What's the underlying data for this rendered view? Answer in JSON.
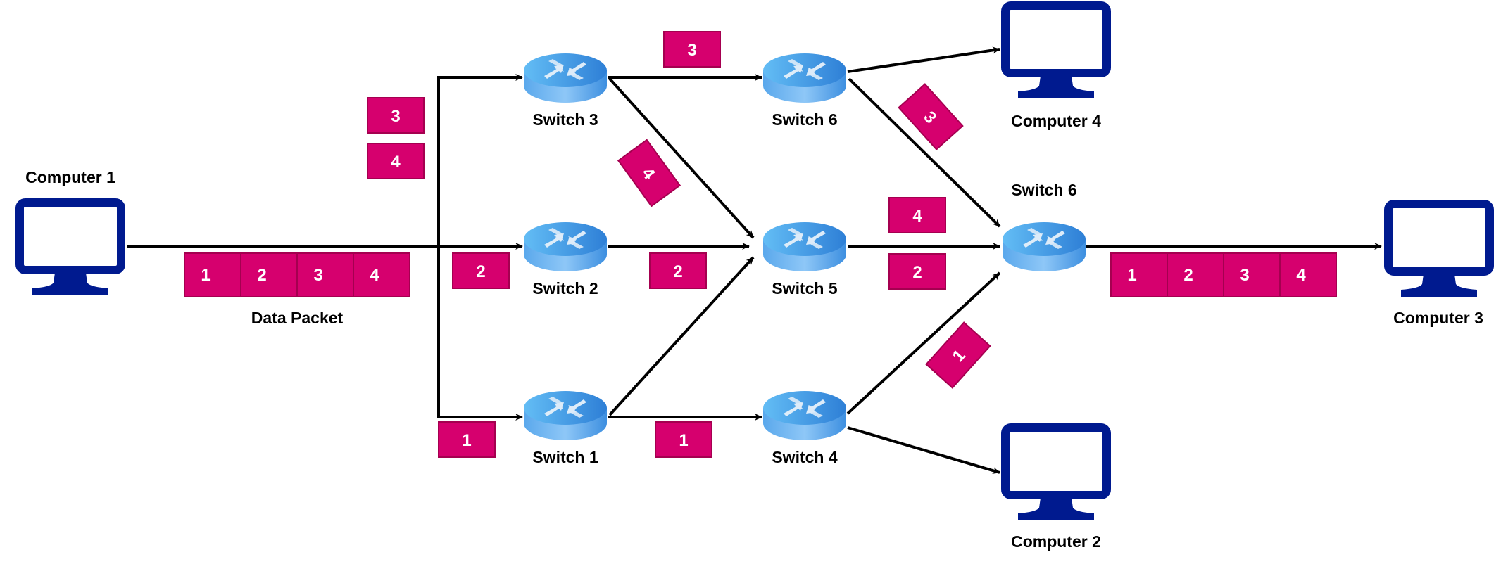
{
  "diagram": {
    "colors": {
      "packet_fill": "#D6006E",
      "packet_border": "#A50050",
      "computer": "#001A8F",
      "switch_top": "#5AB4F0",
      "switch_side": "#3D8FE0",
      "edge": "#000000"
    },
    "nodes": {
      "computer1": {
        "label": "Computer 1"
      },
      "computer2": {
        "label": "Computer 2"
      },
      "computer3": {
        "label": "Computer 3"
      },
      "computer4": {
        "label": "Computer 4"
      },
      "switch1": {
        "label": "Switch 1"
      },
      "switch2": {
        "label": "Switch 2"
      },
      "switch3": {
        "label": "Switch 3"
      },
      "switch4": {
        "label": "Switch 4"
      },
      "switch5": {
        "label": "Switch 5"
      },
      "switch6_top": {
        "label": "Switch 6"
      },
      "switch6_right": {
        "label": "Switch 6"
      }
    },
    "data_packet": {
      "label": "Data Packet",
      "segments": [
        "1",
        "2",
        "3",
        "4"
      ]
    },
    "received_packet": {
      "segments": [
        "1",
        "2",
        "3",
        "4"
      ]
    },
    "packets": {
      "branch_top_3": "3",
      "branch_top_4": "4",
      "to_switch2": "2",
      "to_switch1": "1",
      "s3_to_s6": "3",
      "s3_to_s5": "4",
      "s2_to_s5": "2",
      "s1_to_s4": "1",
      "s6_to_s6r": "3",
      "s5_to_s6r_4": "4",
      "s5_to_s6r_2": "2",
      "s4_to_s6r": "1"
    },
    "edges": [
      {
        "from": "Computer 1",
        "to": "Switch 3"
      },
      {
        "from": "Computer 1",
        "to": "Switch 2"
      },
      {
        "from": "Computer 1",
        "to": "Switch 1"
      },
      {
        "from": "Switch 3",
        "to": "Switch 6"
      },
      {
        "from": "Switch 3",
        "to": "Switch 5"
      },
      {
        "from": "Switch 2",
        "to": "Switch 5"
      },
      {
        "from": "Switch 1",
        "to": "Switch 5"
      },
      {
        "from": "Switch 1",
        "to": "Switch 4"
      },
      {
        "from": "Switch 6",
        "to": "Computer 4"
      },
      {
        "from": "Switch 6",
        "to": "Switch 6 (right)"
      },
      {
        "from": "Switch 5",
        "to": "Switch 6 (right)"
      },
      {
        "from": "Switch 4",
        "to": "Switch 6 (right)"
      },
      {
        "from": "Switch 4",
        "to": "Computer 2"
      },
      {
        "from": "Switch 6 (right)",
        "to": "Computer 3"
      }
    ]
  }
}
